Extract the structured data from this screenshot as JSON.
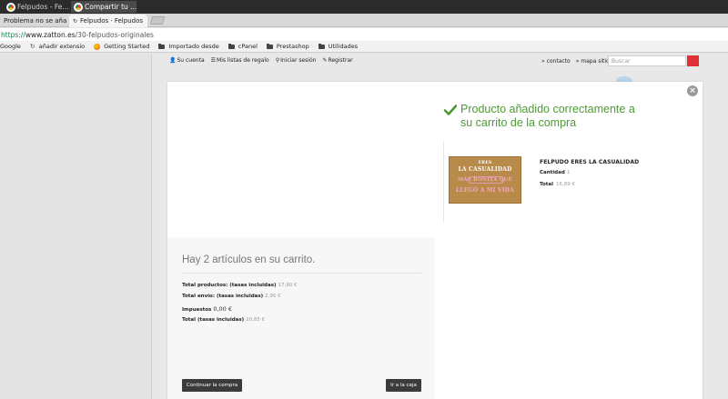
{
  "os_taskbar": {
    "tasks": [
      {
        "label": "Felpudos - Fe..."
      },
      {
        "label": "Compartir tu ..."
      }
    ]
  },
  "browser": {
    "tabs": [
      {
        "label": "Problema no se aña",
        "close": "×"
      },
      {
        "label": "Felpudos · Felpudos",
        "close": "×"
      }
    ],
    "address": {
      "scheme": "https://",
      "host": "www.zatton.es",
      "path": "/30-felpudos-originales"
    },
    "bookmarks": [
      {
        "label": "Google",
        "icon": "google-icon"
      },
      {
        "label": "añadir extensio",
        "icon": "refresh-icon"
      },
      {
        "label": "Getting Started",
        "icon": "firefox-icon"
      },
      {
        "label": "Importado desde",
        "icon": "folder-icon"
      },
      {
        "label": "cPanel",
        "icon": "folder-icon"
      },
      {
        "label": "Prestashop",
        "icon": "folder-icon"
      },
      {
        "label": "Utilidades",
        "icon": "folder-icon"
      }
    ]
  },
  "site_header": {
    "nav": [
      {
        "label": "Su cuenta",
        "icon": "user-icon"
      },
      {
        "label": "Mis listas de regalo",
        "icon": "list-icon"
      },
      {
        "label": "Iniciar sesión",
        "icon": "key-icon"
      },
      {
        "label": "Registrar",
        "icon": "edit-icon"
      }
    ],
    "contact": "» contacto",
    "sitemap": "» mapa sitio",
    "search": {
      "placeholder": "Buscar"
    }
  },
  "modal": {
    "close": "×",
    "success_message": "Producto añadido correctamente a su carrito de la compra",
    "product": {
      "name": "FELPUDO ERES LA CASUALIDAD",
      "quantity_label": "Cantidad",
      "quantity": "1",
      "total_label": "Total",
      "total": "16,89 €",
      "image_text": [
        "ERES",
        "LA CASUALIDAD",
        "MÁS BONITA QUE",
        "LLEGÓ A MI VIDA"
      ]
    },
    "cart": {
      "title": "Hay 2 artículos en su carrito.",
      "rows": [
        {
          "label": "Total productos: (tasas incluidas)",
          "value": "17,90 €"
        },
        {
          "label": "Total envío: (tasas incluidas)",
          "value": "2,95 €"
        },
        {
          "label": "Impuestos",
          "value": "0,00 €"
        },
        {
          "label": "Total (tasas incluidas)",
          "value": "20,85 €"
        }
      ],
      "continue_label": "Continuar la compra",
      "checkout_label": "Ir a la caja"
    }
  },
  "colors": {
    "success": "#4d9a35",
    "button": "#3b3b3b",
    "search_button": "#e03035"
  }
}
